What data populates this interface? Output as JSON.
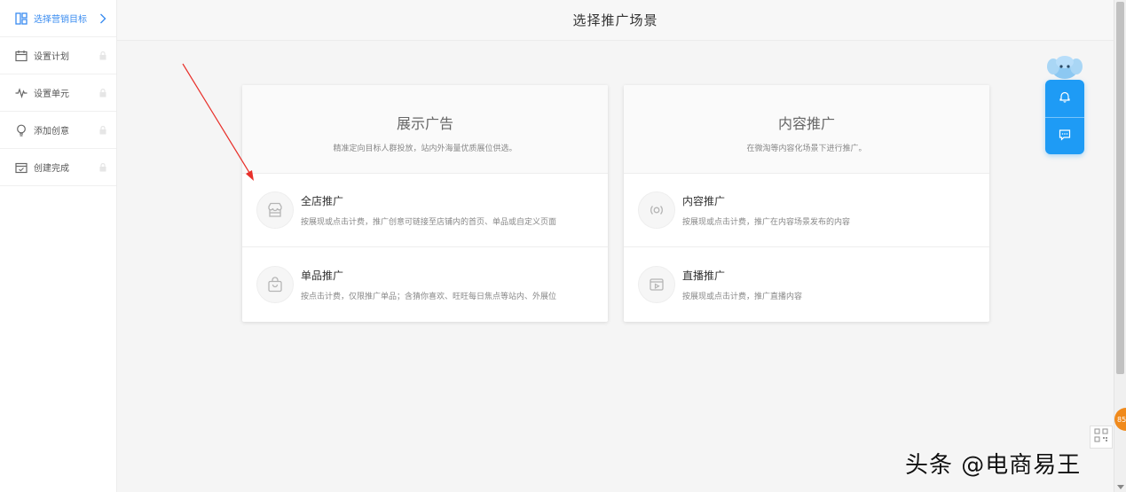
{
  "sidebar": {
    "items": [
      {
        "label": "选择营销目标",
        "icon": "layout-icon",
        "active": true
      },
      {
        "label": "设置计划",
        "icon": "calendar-icon",
        "active": false
      },
      {
        "label": "设置单元",
        "icon": "pulse-icon",
        "active": false
      },
      {
        "label": "添加创意",
        "icon": "bulb-icon",
        "active": false
      },
      {
        "label": "创建完成",
        "icon": "calendar-check-icon",
        "active": false
      }
    ]
  },
  "header": {
    "title": "选择推广场景"
  },
  "cards": [
    {
      "title": "展示广告",
      "desc": "精准定向目标人群投放，站内外海量优质展位供选。",
      "options": [
        {
          "title": "全店推广",
          "desc": "按展现或点击计费，推广创意可链接至店铺内的首页、单品或自定义页面",
          "icon": "shop-icon"
        },
        {
          "title": "单品推广",
          "desc": "按点击计费，仅限推广单品；含猜你喜欢、旺旺每日焦点等站内、外展位",
          "icon": "bag-icon"
        }
      ]
    },
    {
      "title": "内容推广",
      "desc": "在微淘等内容化场景下进行推广。",
      "options": [
        {
          "title": "内容推广",
          "desc": "按展现或点击计费，推广在内容场景发布的内容",
          "icon": "broadcast-icon"
        },
        {
          "title": "直播推广",
          "desc": "按展现或点击计费，推广直播内容",
          "icon": "video-icon"
        }
      ]
    }
  ],
  "float_widget": {
    "buttons": [
      "bell-icon",
      "message-icon"
    ]
  },
  "badge": {
    "text": "85"
  },
  "watermark": {
    "text": "头条 @电商易王"
  },
  "colors": {
    "accent": "#3a8cf0",
    "float_blue": "#1e9bf5",
    "annotation_red": "#e8302a"
  }
}
